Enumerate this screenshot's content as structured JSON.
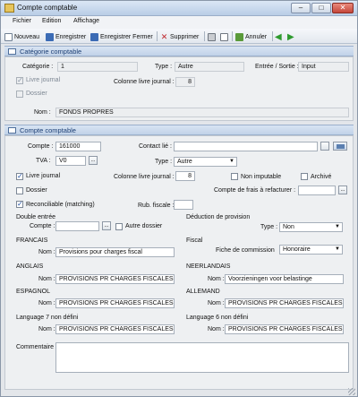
{
  "window": {
    "title": "Compte comptable"
  },
  "menu": [
    "Fichier",
    "Edition",
    "Affichage"
  ],
  "toolbar": {
    "nouveau": "Nouveau",
    "enregistrer": "Enregistrer",
    "enregistrer_fermer": "Enregistrer Fermer",
    "supprimer": "Supprimer",
    "annuler": "Annuler"
  },
  "categorie": {
    "header": "Catégorie comptable",
    "categorie_label": "Catégorie :",
    "categorie_value": "1",
    "type_label": "Type :",
    "type_value": "Autre",
    "es_label": "Entrée / Sortie :",
    "es_value": "Input",
    "livre_journal_label": "Livre journal",
    "colonne_label": "Colonne livre journal :",
    "colonne_value": "8",
    "dossier_label": "Dossier",
    "nom_label": "Nom :",
    "nom_value": "FONDS PROPRES"
  },
  "compte": {
    "header": "Compte comptable",
    "compte_label": "Compte :",
    "compte_value": "161000",
    "contact_label": "Contact lié :",
    "contact_value": "",
    "tva_label": "TVA :",
    "tva_value": "V0",
    "type_label": "Type :",
    "type_value": "Autre",
    "livre_journal_label": "Livre journal",
    "colonne_label": "Colonne livre journal :",
    "colonne_value": "8",
    "non_imputable_label": "Non imputable",
    "archive_label": "Archivé",
    "dossier_label": "Dossier",
    "frais_label": "Compte de frais à refacturer :",
    "frais_value": "",
    "reconciliable_label": "Reconciliable (matching)",
    "rub_label": "Rub. fiscale :",
    "rub_value": "",
    "double_entree_label": "Double entrée",
    "de_compte_label": "Compte :",
    "de_compte_value": "",
    "autre_dossier_label": "Autre dossier",
    "deduction_label": "Déduction de provision",
    "deduction_type_label": "Type :",
    "deduction_type_value": "Non",
    "francais_label": "FRANCAIS",
    "francais_nom_label": "Nom :",
    "francais_nom_value": "Provisions pour charges fiscal",
    "fiscal_label": "Fiscal",
    "fiche_label": "Fiche de commission",
    "fiche_value": "Honoraire",
    "anglais_label": "ANGLAIS",
    "anglais_nom_label": "Nom :",
    "anglais_nom_value": "PROVISIONS PR CHARGES FISCALES",
    "neerlandais_label": "NEERLANDAIS",
    "neerlandais_nom_label": "Nom :",
    "neerlandais_nom_value": "Voorzieningen voor belastinge",
    "espagnol_label": "ESPAGNOL",
    "espagnol_nom_label": "Nom :",
    "espagnol_nom_value": "PROVISIONS PR CHARGES FISCALES",
    "allemand_label": "ALLEMAND",
    "allemand_nom_label": "Nom :",
    "allemand_nom_value": "PROVISIONS PR CHARGES FISCALES",
    "lang7_label": "Language 7 non défini",
    "lang7_nom_label": "Nom :",
    "lang7_nom_value": "PROVISIONS PR CHARGES FISCALES",
    "lang6_label": "Language 6 non défini",
    "lang6_nom_label": "Nom :",
    "lang6_nom_value": "PROVISIONS PR CHARGES FISCALES",
    "commentaire_label": "Commentaire",
    "commentaire_value": ""
  },
  "buttons": {
    "ellipsis": "..."
  },
  "colors": {
    "accent": "#1d3f74",
    "header_bg": "#c1d2e8"
  }
}
